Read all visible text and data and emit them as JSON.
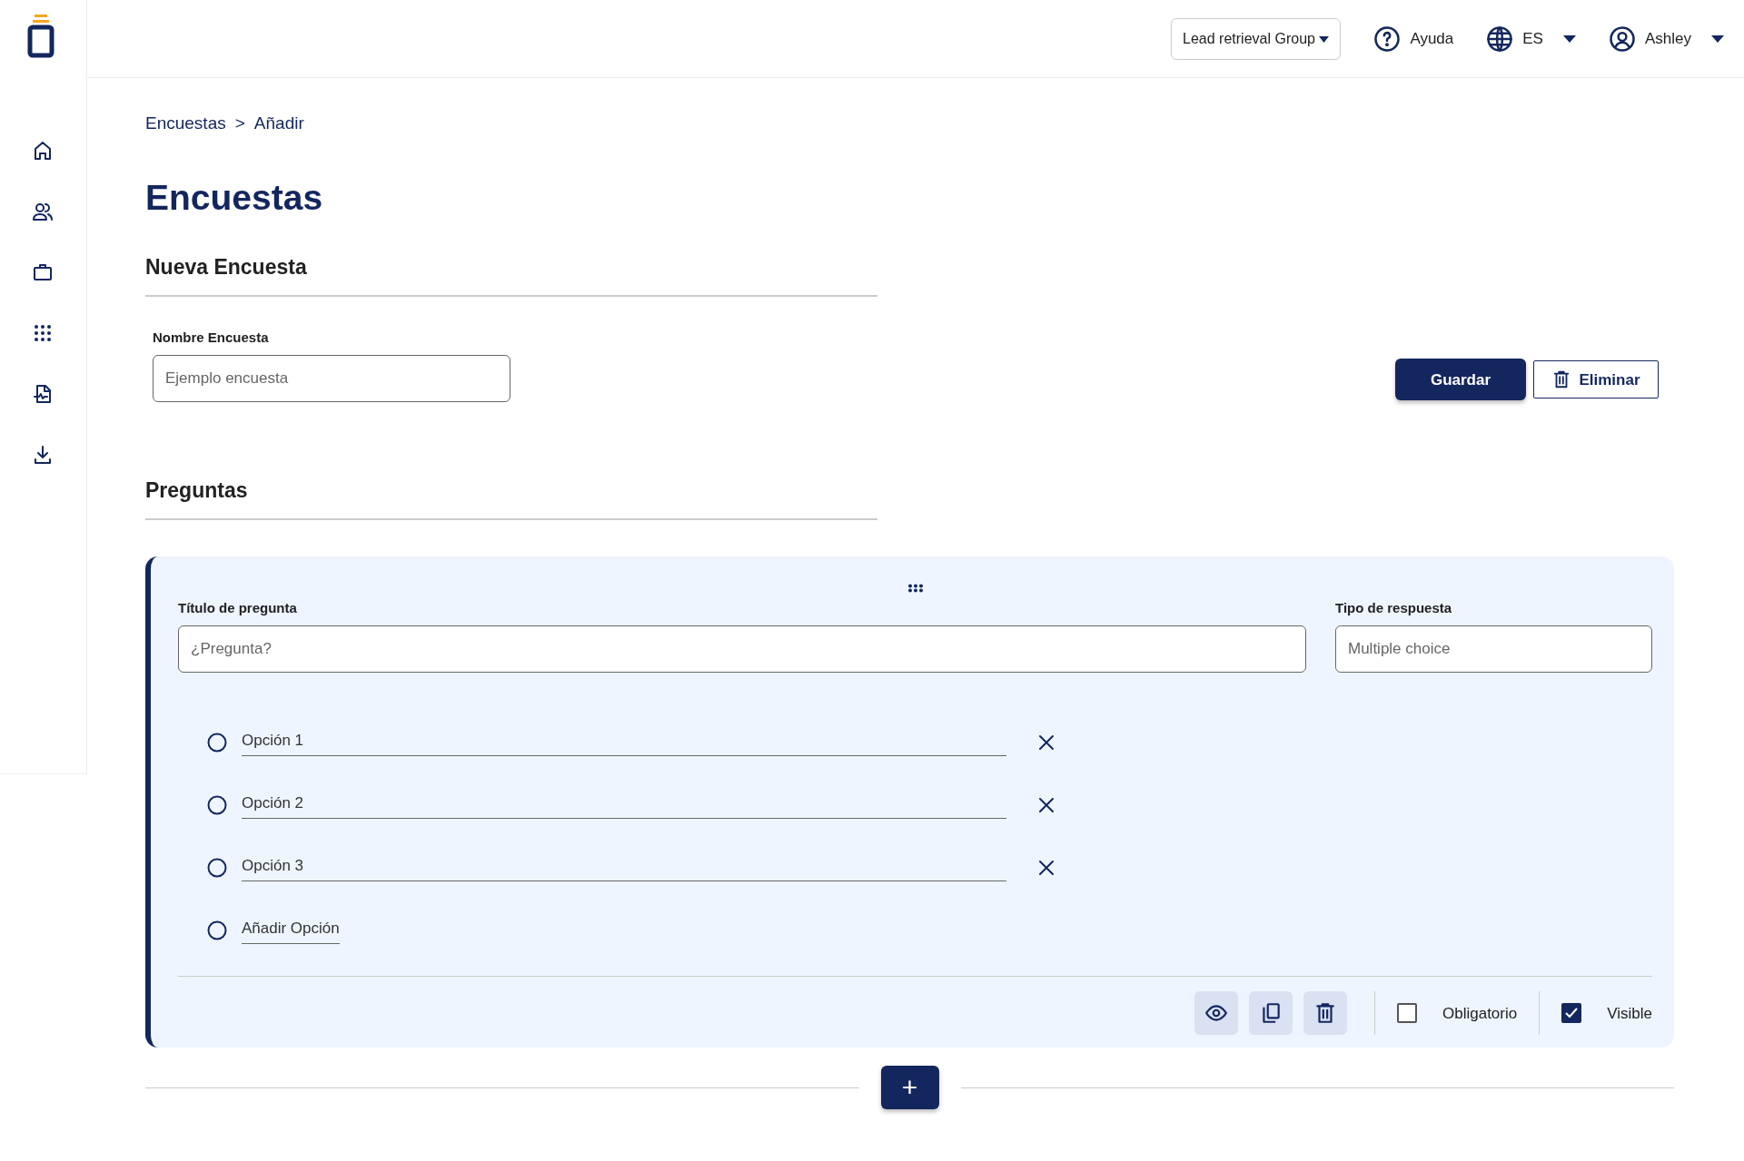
{
  "topbar": {
    "group": "Lead retrieval Group",
    "help": "Ayuda",
    "language": "ES",
    "user": "Ashley"
  },
  "breadcrumb": [
    {
      "label": "Encuestas"
    },
    {
      "label": ">"
    },
    {
      "label": "Añadir"
    }
  ],
  "page_title": "Encuestas",
  "section_title": "Nueva Encuesta",
  "survey_name": {
    "label": "Nombre Encuesta",
    "placeholder": "Ejemplo encuesta"
  },
  "buttons": {
    "save": "Guardar",
    "delete": "Eliminar"
  },
  "questions_title": "Preguntas",
  "question": {
    "title_label": "Título de pregunta",
    "title_placeholder": "¿Pregunta?",
    "type_label": "Tipo de respuesta",
    "type_placeholder": "Multiple choice",
    "options": [
      {
        "kind": "option",
        "value": "Opción 1",
        "selected": false
      },
      {
        "kind": "option",
        "value": "Opción 2",
        "selected": false
      },
      {
        "kind": "option",
        "value": "Opción 3",
        "selected": false
      },
      {
        "kind": "add",
        "value": "Añadir Opción",
        "selected": false
      }
    ],
    "required": {
      "label": "Obligatorio",
      "checked": false
    },
    "visible": {
      "label": "Visible",
      "checked": true
    }
  },
  "add_button": "+"
}
